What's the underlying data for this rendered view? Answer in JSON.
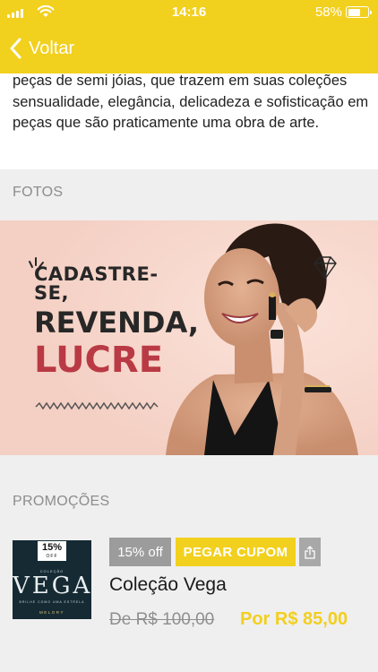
{
  "status_bar": {
    "time": "14:16",
    "battery_percent": "58%",
    "battery_level": 0.58
  },
  "nav": {
    "back_label": "Voltar",
    "back_icon": "chevron-left-icon",
    "accent_color": "#f2d01e"
  },
  "about": {
    "text": "peças de semi jóias, que trazem em suas coleções sensualidade, elegância, delicadeza e sofisticação em peças que são praticamente uma obra de arte."
  },
  "photos": {
    "section_label": "FOTOS",
    "banner": {
      "line1": "CADASTRE-SE,",
      "line2": "REVENDA,",
      "line3": "LUCRE"
    }
  },
  "promotions": {
    "section_label": "PROMOÇÕES",
    "items": [
      {
        "thumb_badge_pct": "15%",
        "thumb_badge_off": "OFF",
        "thumb_collection": "COLEÇÃO",
        "thumb_title": "VEGA",
        "thumb_subtitle": "BRILHE COMO UMA ESTRELA",
        "thumb_brand": "MELORY",
        "discount_label": "15% off",
        "coupon_button": "PEGAR CUPOM",
        "share_icon": "share-icon",
        "title": "Coleção Vega",
        "old_price": "De R$ 100,00",
        "new_price": "Por R$ 85,00"
      }
    ]
  }
}
